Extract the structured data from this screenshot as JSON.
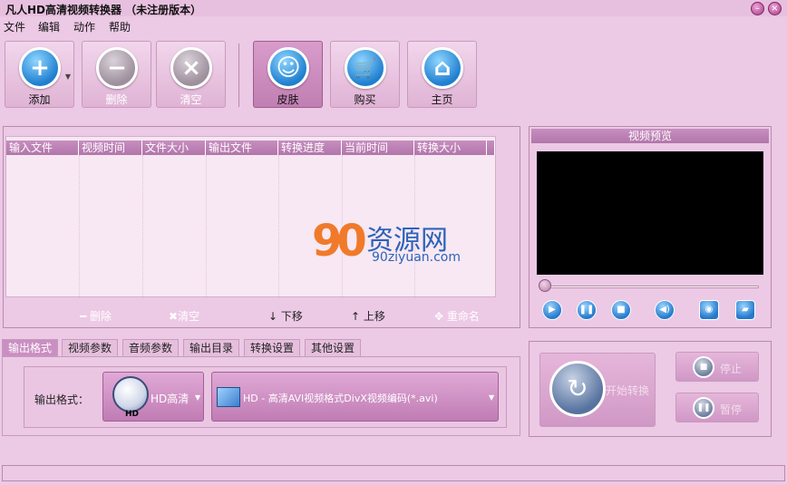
{
  "window": {
    "title": "凡人HD高清视频转换器 （未注册版本）",
    "min_glyph": "–",
    "close_glyph": "×"
  },
  "menu": [
    "文件",
    "编辑",
    "动作",
    "帮助"
  ],
  "toolbar": {
    "add": "添加",
    "delete": "删除",
    "clear": "清空",
    "skin": "皮肤",
    "buy": "购买",
    "home": "主页",
    "add_glyph": "+",
    "delete_glyph": "−",
    "clear_glyph": "×",
    "skin_glyph": "☺",
    "buy_glyph": "🛒",
    "home_glyph": "⌂"
  },
  "file_table": {
    "columns": [
      "输入文件",
      "视频时间",
      "文件大小",
      "输出文件",
      "转换进度",
      "当前时间",
      "转换大小"
    ],
    "rows": []
  },
  "watermark": {
    "logo": "90",
    "name": "资源网",
    "url": "90ziyuan.com"
  },
  "file_actions": {
    "delete": "删除",
    "clear": "清空",
    "down": "下移",
    "up": "上移",
    "rename": "重命名"
  },
  "preview": {
    "title": "视频预览",
    "progress": 0,
    "controls": [
      "play-icon",
      "pause-icon",
      "stop-icon",
      "volume-icon",
      "snapshot-icon",
      "folder-icon"
    ]
  },
  "tabs": [
    "输出格式",
    "视频参数",
    "音频参数",
    "输出目录",
    "转换设置",
    "其他设置"
  ],
  "active_tab": 0,
  "output_format": {
    "label": "输出格式：",
    "category": "HD高清",
    "category_tag": "HD",
    "format": "HD - 高清AVI视频格式DivX视频编码(*.avi)"
  },
  "actions": {
    "start": "开始转换",
    "stop": "停止",
    "pause": "暂停"
  },
  "status": "",
  "colors": {
    "background": "#ecc9e5",
    "accent": "#c07cb4",
    "header": "#b276aa",
    "icon_blue": "#1f7fd0"
  }
}
